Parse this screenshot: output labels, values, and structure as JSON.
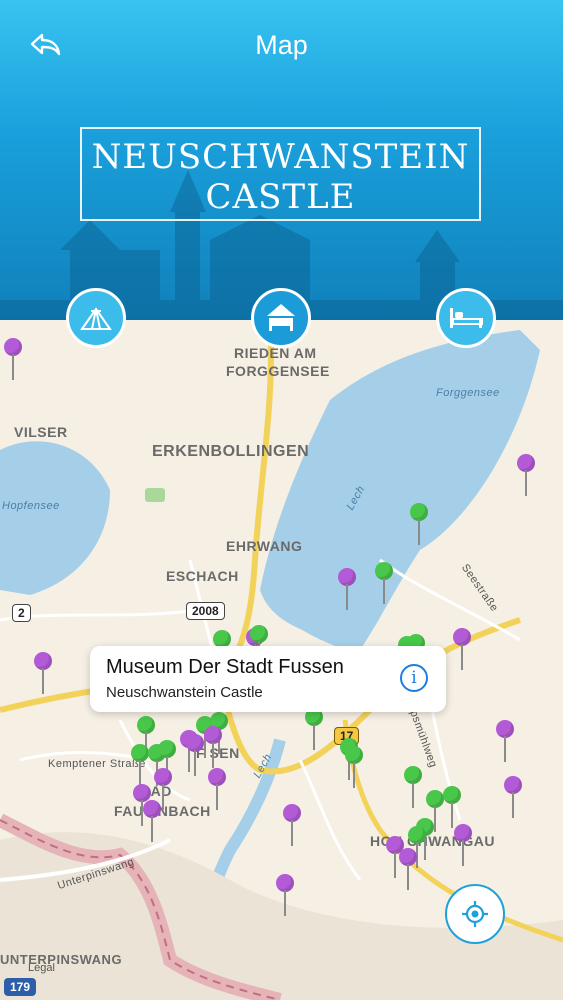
{
  "nav": {
    "title": "Map"
  },
  "banner": {
    "line1": "NEUSCHWANSTEIN",
    "line2": "CASTLE"
  },
  "categories": [
    {
      "icon": "tent-icon"
    },
    {
      "icon": "bed-icon"
    },
    {
      "icon": "hotel-bed-icon"
    }
  ],
  "map": {
    "places": {
      "rieden1": "RIEDEN AM",
      "rieden2": "FORGGENSEE",
      "vilser": "VILSER",
      "erkenbollingen": "ERKENBOLLINGEN",
      "ehrwang": "EHRWANG",
      "eschach": "ESCHACH",
      "fussen": "F    SEN",
      "bad": "BAD",
      "faulenbach": "FAU  ENBACH",
      "hohenschwangau": "HOH    CHWANGAU",
      "unterpinswang": "UNTERPINSWANG"
    },
    "streets": {
      "kemptener": "Kemptener Straße",
      "seestrasse": "Seestraße",
      "sipsmuhlweg": "Sipsmühlweg",
      "unterpinswang": "Unterpinswang",
      "lech1": "Lech",
      "lech2": "Lech"
    },
    "water": {
      "forggensee": "Forggensee",
      "hopfensee": "Hopfensee"
    },
    "shields": {
      "r2": "2",
      "r2008": "2008",
      "r17": "17",
      "r179": "179"
    },
    "legal": "Legal"
  },
  "callout": {
    "title": "Museum Der Stadt Fussen",
    "subtitle": "Neuschwanstein Castle",
    "info": "i"
  },
  "colors": {
    "header": "#1aa0dc",
    "pin_purple": "#b35ad6",
    "pin_green": "#48c74a",
    "water": "#a5cfe9"
  }
}
